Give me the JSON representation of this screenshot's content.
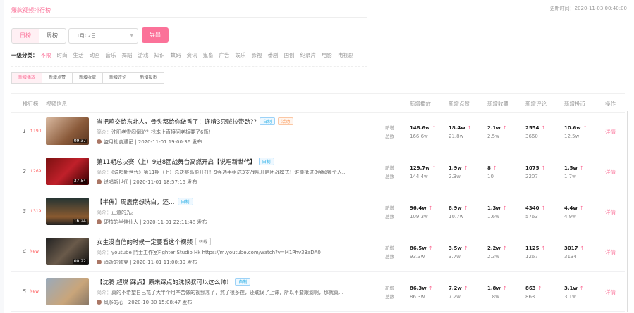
{
  "header": {
    "title": "爆款视频排行榜",
    "updated": "更新时间：2020-11-03 00:40:00"
  },
  "controls": {
    "day": "日榜",
    "week": "周榜",
    "date": "11月02日",
    "export": "导出"
  },
  "categories": {
    "label": "一级分类：",
    "items": [
      "不限",
      "时尚",
      "生活",
      "动画",
      "音乐",
      "舞蹈",
      "游戏",
      "知识",
      "数码",
      "资讯",
      "鬼畜",
      "广告",
      "娱乐",
      "影视",
      "番剧",
      "国创",
      "纪录片",
      "电影",
      "电视剧"
    ]
  },
  "metric_tabs": [
    "新增播放",
    "新增点赞",
    "新增收藏",
    "新增评论",
    "新增投币"
  ],
  "columns": {
    "rank": "排行榜",
    "info": "视频信息",
    "play": "新增播放",
    "like": "新增点赞",
    "fav": "新增收藏",
    "comment": "新增评论",
    "coin": "新增投币",
    "op": "操作"
  },
  "row_labels": {
    "new": "新增",
    "total": "总数",
    "detail": "详情",
    "desc_prefix": "简介："
  },
  "rows": [
    {
      "rank": "1",
      "change": "↑190",
      "duration": "09:37",
      "title": "当把鸡交给东北人，骨头都给你做香了！连啃3只贼拉带劲??",
      "tags": [
        "自制",
        "活动"
      ],
      "desc": "沈阳老雪闷倒驴？找本上直接问老板要了6瓶！",
      "author": "盗月社食遇记",
      "time": "| 2020-11-01 19:00:36 发布",
      "play": [
        "148.6w",
        "166.6w"
      ],
      "like": [
        "18.4w",
        "21.8w"
      ],
      "fav": [
        "2.1w",
        "2.5w"
      ],
      "comment": [
        "2554",
        "3660"
      ],
      "coin": [
        "10.6w",
        "12.5w"
      ]
    },
    {
      "rank": "2",
      "change": "↑269",
      "duration": "37:54",
      "title": "第11期总决赛（上）9进8团战舞台高燃开启【说唱新世代】",
      "tags": [
        "自制"
      ],
      "desc": "《说唱新世代》第11期（上）总决赛高能开打！9强选手组成3支战队开启团战模式！谁能挺进8强解锁个人…",
      "author": "说唱新世代",
      "time": "| 2020-11-01 18:57:15 发布",
      "play": [
        "129.7w",
        "144.4w"
      ],
      "like": [
        "1.9w",
        "2.3w"
      ],
      "fav": [
        "8",
        "10"
      ],
      "comment": [
        "1075",
        "2207"
      ],
      "coin": [
        "1.5w",
        "1.7w"
      ]
    },
    {
      "rank": "3",
      "change": "↑319",
      "duration": "16:24",
      "title": "【半佛】周震南想洗白，还…",
      "tags": [
        "自制"
      ],
      "desc": "正道的光。",
      "author": "硬核的半佛仙人",
      "time": "| 2020-11-01 22:11:48 发布",
      "play": [
        "96.4w",
        "109.3w"
      ],
      "like": [
        "8.9w",
        "10.7w"
      ],
      "fav": [
        "1.3w",
        "1.6w"
      ],
      "comment": [
        "4340",
        "5763"
      ],
      "coin": [
        "4.4w",
        "4.9w"
      ]
    },
    {
      "rank": "4",
      "change": "New",
      "duration": "00:22",
      "title": "女生没自信的时候一定要看这个视频",
      "tags": [
        "转载"
      ],
      "desc": "youtube 鬥士工作室Fighter Studio Hk https://m.youtube.com/watch?v=M1Phv33aDA0",
      "author": "消逝的迪克",
      "time": "| 2020-11-01 11:00:39 发布",
      "play": [
        "86.5w",
        "93.3w"
      ],
      "like": [
        "3.5w",
        "3.7w"
      ],
      "fav": [
        "2.2w",
        "2.3w"
      ],
      "comment": [
        "1125",
        "1267"
      ],
      "coin": [
        "3017",
        "3134"
      ]
    },
    {
      "rank": "5",
      "change": "New",
      "duration": "",
      "title": "【沈腾 超燃 踩点】原来踩点的沈叔叔可以这么帅！",
      "tags": [
        "自制"
      ],
      "desc": "真的不希望自己花了大半个月辛苦做的视频凉了，熬了很多夜，还耽误了上课，所以不要跟滤啊，那就真…",
      "author": "风筝的心",
      "time": "| 2020-10-30 15:08:47 发布",
      "play": [
        "86.3w",
        "86.3w"
      ],
      "like": [
        "7.2w",
        "7.2w"
      ],
      "fav": [
        "1.8w",
        "1.8w"
      ],
      "comment": [
        "863",
        "863"
      ],
      "coin": [
        "3.1w",
        "3.1w"
      ]
    }
  ]
}
